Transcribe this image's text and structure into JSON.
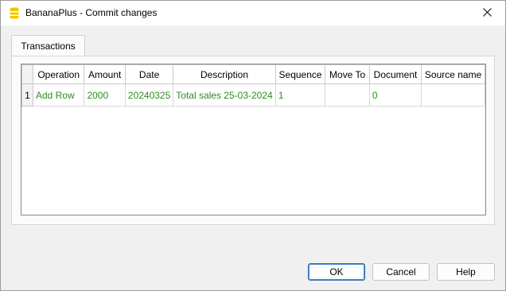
{
  "window": {
    "title": "BananaPlus - Commit changes"
  },
  "icons": {
    "app": "banana-plus-app-icon",
    "close": "close-icon"
  },
  "tabs": [
    {
      "label": "Transactions",
      "selected": true
    }
  ],
  "grid": {
    "columns": [
      "Operation",
      "Amount",
      "Date",
      "Description",
      "Sequence",
      "Move To",
      "Document",
      "Source name"
    ],
    "rows": [
      {
        "row_number": "1",
        "cells": [
          "Add Row",
          "2000",
          "20240325",
          "Total sales 25-03-2024",
          "1",
          "",
          "0",
          ""
        ]
      }
    ]
  },
  "buttons": {
    "ok": "OK",
    "cancel": "Cancel",
    "help": "Help"
  },
  "colors": {
    "changed_text": "#2e8b20",
    "app_icon": "#f4c400",
    "default_button_border": "#2f6fb5"
  }
}
